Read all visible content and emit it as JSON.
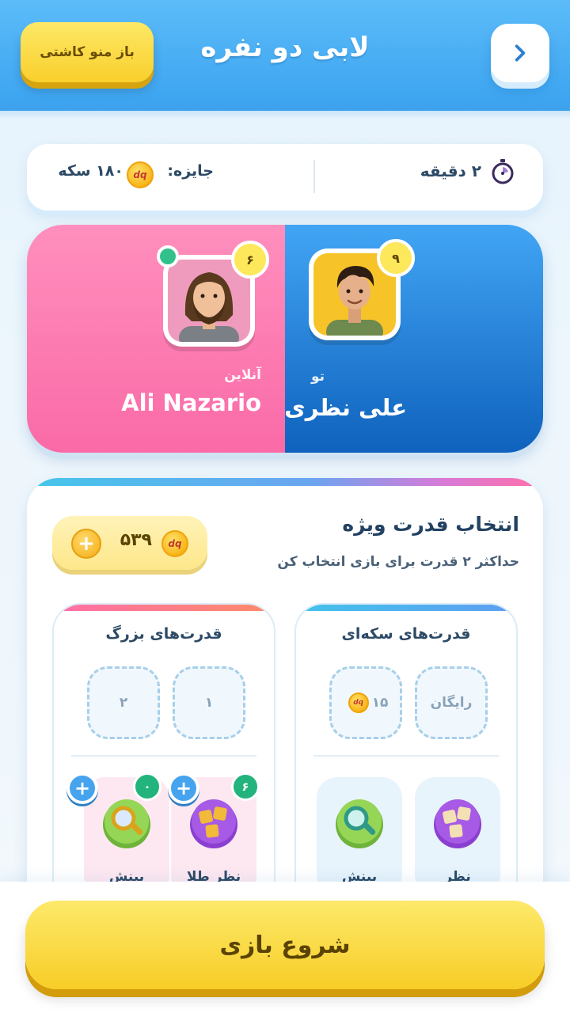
{
  "header": {
    "title": "لابی دو نفره",
    "refresh_label": "باز منو کاشتی",
    "back_icon": "chevron-right-icon"
  },
  "match_info": {
    "duration": "۲ دقیقه",
    "prize_label": "جایزه:",
    "prize_value": "۱۸۰ سکه",
    "coin_symbol": "dq"
  },
  "players": {
    "me": {
      "level": "۹",
      "label": "تو",
      "name": "علی نظری"
    },
    "opponent": {
      "level": "۶",
      "status": "آنلاین",
      "name": "Ali Nazario"
    }
  },
  "powers": {
    "title": "انتخاب قدرت ویژه",
    "subtitle": "حداکثر ۲ قدرت برای بازی انتخاب کن",
    "coins": "۵۳۹",
    "coin_symbol": "dq",
    "coin_panel": {
      "title": "قدرت‌های سکه‌ای",
      "slots": [
        "رایگان",
        "۱۵"
      ],
      "tiles": [
        {
          "label": "نظر",
          "icon": "letter-tiles-icon"
        },
        {
          "label": "بینش",
          "icon": "magnifier-icon"
        }
      ]
    },
    "big_panel": {
      "title": "قدرت‌های بزرگ",
      "slots": [
        "۱",
        "۲"
      ],
      "tiles": [
        {
          "label": "نظر طلا",
          "icon": "letter-tiles-icon",
          "count": "۶"
        },
        {
          "label": "بینش",
          "icon": "magnifier-icon",
          "count": "۰"
        }
      ]
    }
  },
  "start_button": "شروع بازی",
  "colors": {
    "header_blue": "#3aa2ef",
    "opponent_pink": "#fa6aa7",
    "me_blue": "#0f62bd",
    "button_yellow": "#f7cd27",
    "count_green": "#23b37d"
  }
}
